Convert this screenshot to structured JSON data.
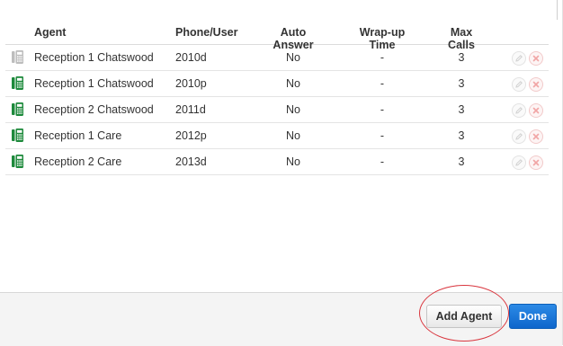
{
  "columns": {
    "agent": "Agent",
    "phone": "Phone/User",
    "auto_answer": "Auto Answer",
    "wrap_up": "Wrap-up Time",
    "max_calls": "Max Calls"
  },
  "rows": [
    {
      "agent": "Reception 1 Chatswood",
      "phone": "2010d",
      "auto_answer": "No",
      "wrap_up": "-",
      "max_calls": "3",
      "phone_status": "inactive"
    },
    {
      "agent": "Reception 1 Chatswood",
      "phone": "2010p",
      "auto_answer": "No",
      "wrap_up": "-",
      "max_calls": "3",
      "phone_status": "active"
    },
    {
      "agent": "Reception 2 Chatswood",
      "phone": "2011d",
      "auto_answer": "No",
      "wrap_up": "-",
      "max_calls": "3",
      "phone_status": "active"
    },
    {
      "agent": "Reception 1 Care",
      "phone": "2012p",
      "auto_answer": "No",
      "wrap_up": "-",
      "max_calls": "3",
      "phone_status": "active"
    },
    {
      "agent": "Reception 2 Care",
      "phone": "2013d",
      "auto_answer": "No",
      "wrap_up": "-",
      "max_calls": "3",
      "phone_status": "active"
    }
  ],
  "icons": {
    "phone": "desk-phone-icon",
    "edit": "pencil-icon",
    "delete": "x-circle-icon"
  },
  "footer": {
    "add_agent_label": "Add Agent",
    "done_label": "Done"
  },
  "colors": {
    "phone_active": "#1e8a3c",
    "phone_inactive": "#bdbdbd",
    "done_button": "#1a73d9",
    "highlight": "#d9363e",
    "delete_icon": "#f1a5a5",
    "edit_icon": "#cfcfcf"
  }
}
